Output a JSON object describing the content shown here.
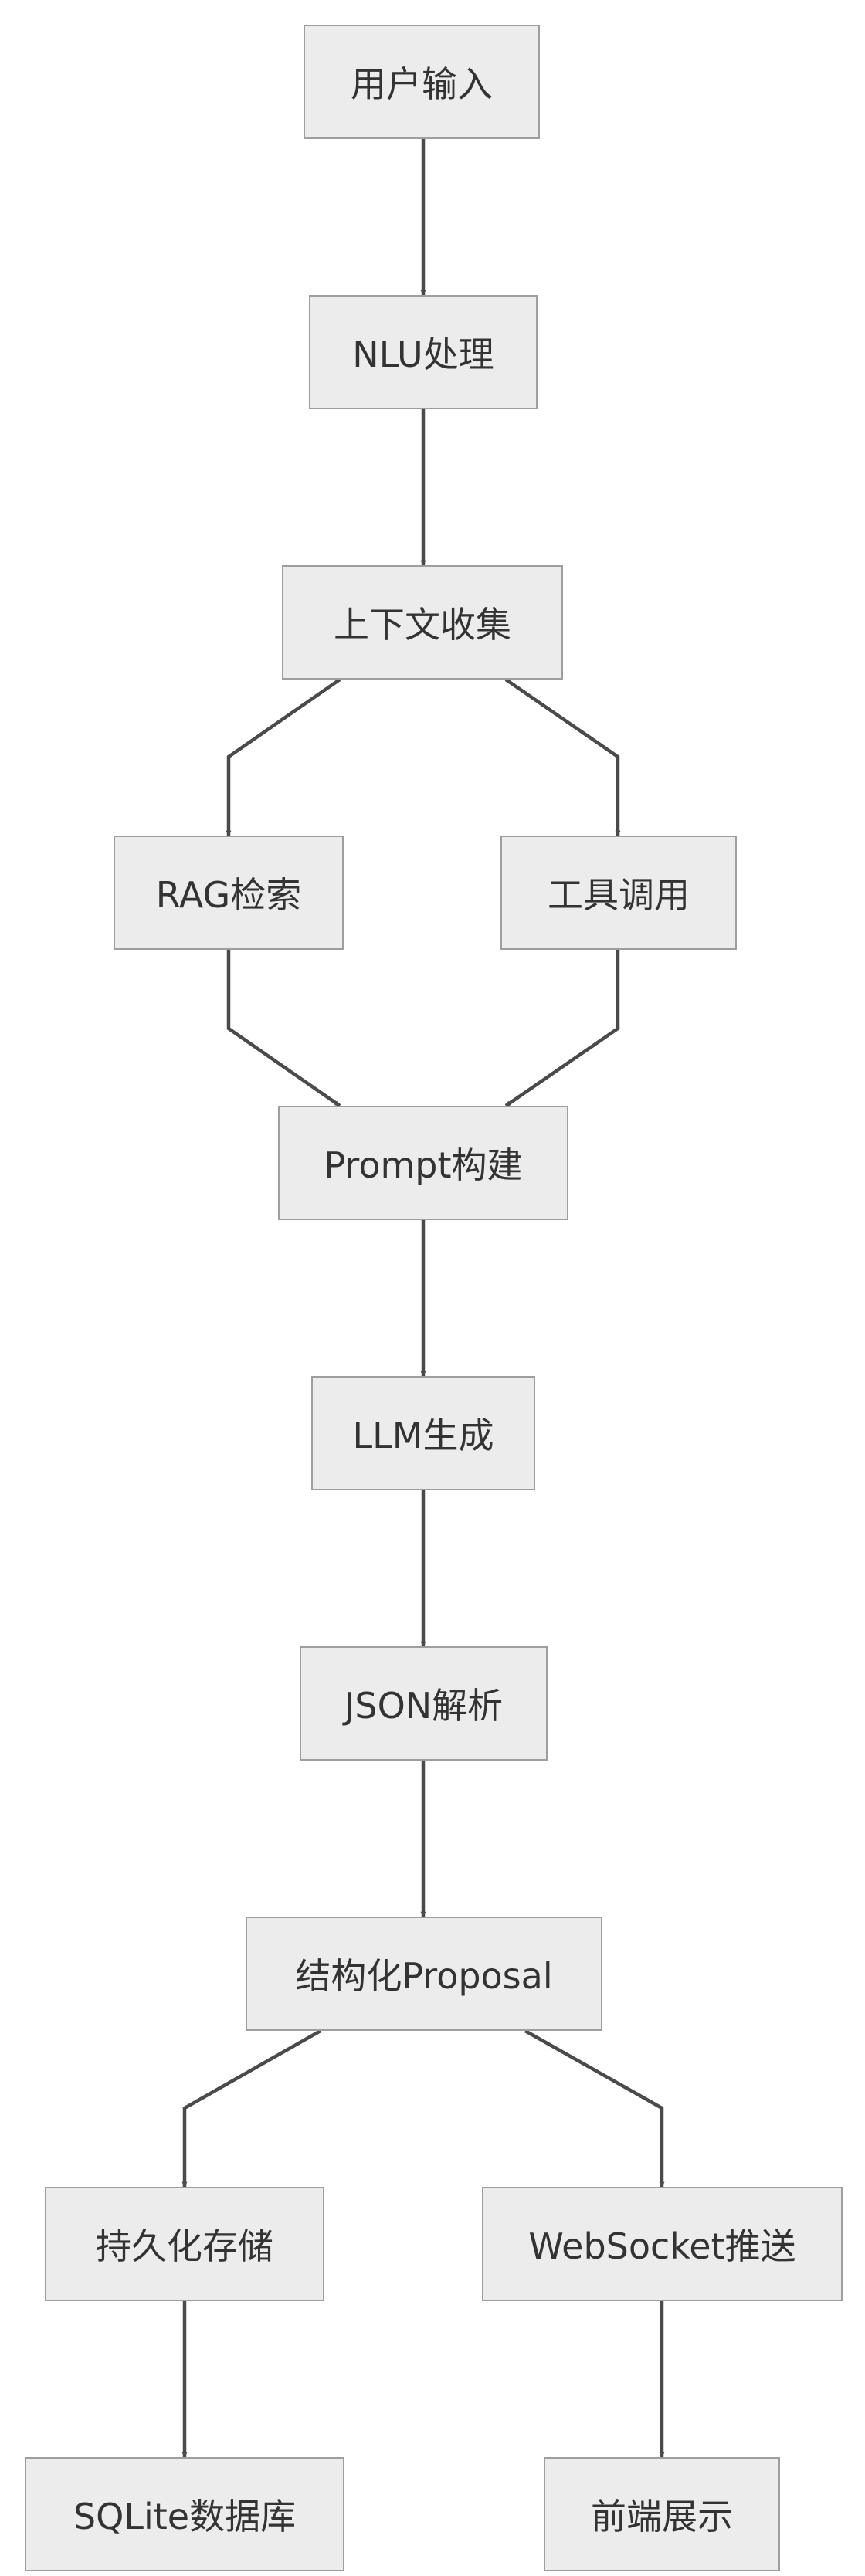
{
  "diagram": {
    "nodes": {
      "input": "用户输入",
      "nlu": "NLU处理",
      "context": "上下文收集",
      "rag": "RAG检索",
      "tool": "工具调用",
      "prompt": "Prompt构建",
      "llm": "LLM生成",
      "json": "JSON解析",
      "proposal": "结构化Proposal",
      "persist": "持久化存储",
      "websocket": "WebSocket推送",
      "sqlite": "SQLite数据库",
      "frontend": "前端展示"
    },
    "edges": [
      {
        "from": "input",
        "to": "nlu"
      },
      {
        "from": "nlu",
        "to": "context"
      },
      {
        "from": "context",
        "to": "rag"
      },
      {
        "from": "context",
        "to": "tool"
      },
      {
        "from": "rag",
        "to": "prompt"
      },
      {
        "from": "tool",
        "to": "prompt"
      },
      {
        "from": "prompt",
        "to": "llm"
      },
      {
        "from": "llm",
        "to": "json"
      },
      {
        "from": "json",
        "to": "proposal"
      },
      {
        "from": "proposal",
        "to": "persist"
      },
      {
        "from": "proposal",
        "to": "websocket"
      },
      {
        "from": "persist",
        "to": "sqlite"
      },
      {
        "from": "websocket",
        "to": "frontend"
      }
    ],
    "colors": {
      "node_fill": "#ececec",
      "node_border": "#9e9e9e",
      "edge": "#4a4a4a",
      "text": "#333333"
    }
  }
}
